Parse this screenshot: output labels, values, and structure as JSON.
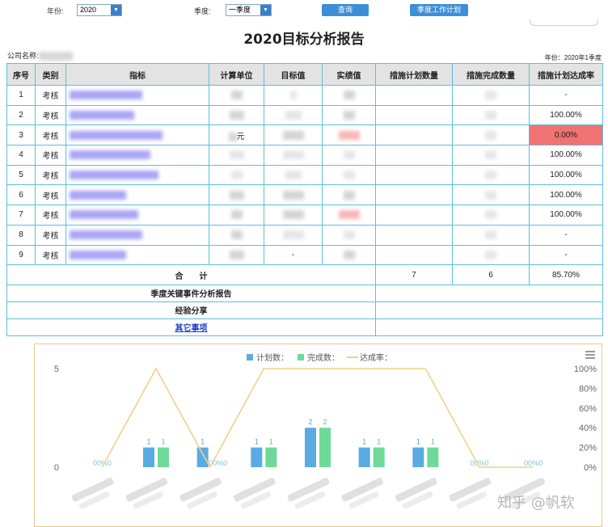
{
  "filters": {
    "year_label": "年份:",
    "year_value": "2020",
    "quarter_label": "季度:",
    "quarter_value": "一季度",
    "query_button": "查询",
    "plan_button": "季度工作计划"
  },
  "report": {
    "title": "2020目标分析报告",
    "company_label": "公司名称:",
    "year_info": "年份：2020年1季度"
  },
  "table": {
    "headers": [
      "序号",
      "类别",
      "指标",
      "计算单位",
      "目标值",
      "实绩值",
      "措施计划数量",
      "措施完成数量",
      "措施计划达成率"
    ],
    "rows": [
      {
        "no": "1",
        "cat": "考核",
        "unit": "",
        "target": "",
        "plan": "",
        "done": "",
        "rate": "-"
      },
      {
        "no": "2",
        "cat": "考核",
        "unit": "",
        "target": "",
        "plan": "",
        "done": "",
        "rate": "100.00%"
      },
      {
        "no": "3",
        "cat": "考核",
        "unit": "元",
        "target": "",
        "plan": "",
        "done": "",
        "rate": "0.00%"
      },
      {
        "no": "4",
        "cat": "考核",
        "unit": "",
        "target": "",
        "plan": "",
        "done": "",
        "rate": "100.00%"
      },
      {
        "no": "5",
        "cat": "考核",
        "unit": "",
        "target": "",
        "plan": "",
        "done": "",
        "rate": "100.00%"
      },
      {
        "no": "6",
        "cat": "考核",
        "unit": "",
        "target": "",
        "plan": "",
        "done": "",
        "rate": "100.00%"
      },
      {
        "no": "7",
        "cat": "考核",
        "unit": "",
        "target": "",
        "plan": "",
        "done": "",
        "rate": "100.00%"
      },
      {
        "no": "8",
        "cat": "考核",
        "unit": "",
        "target": "",
        "plan": "",
        "done": "",
        "rate": "-"
      },
      {
        "no": "9",
        "cat": "考核",
        "unit": "",
        "target": "-",
        "plan": "",
        "done": "",
        "rate": "-"
      }
    ],
    "total_label": "合　　计",
    "total_plan": "7",
    "total_done": "6",
    "total_rate": "85.70%",
    "section_event": "季度关键事件分析报告",
    "section_experience": "经验分享",
    "section_other": "其它事项"
  },
  "chart_data": {
    "type": "bar",
    "legend": [
      "计划数：",
      "完成数：",
      "达成率："
    ],
    "legend_position": "top-center",
    "colors": {
      "plan": "#5aabe3",
      "done": "#6fd99a",
      "rate": "#f0d08a"
    },
    "y_left": {
      "min": 0,
      "max": 5,
      "ticks": [
        "0",
        "5"
      ]
    },
    "y_right": {
      "min": 0,
      "max": 100,
      "ticks": [
        "0%",
        "20%",
        "40%",
        "60%",
        "80%",
        "100%"
      ]
    },
    "series": [
      {
        "name": "计划数：",
        "values": [
          0,
          1,
          1,
          1,
          2,
          1,
          1,
          0,
          0
        ]
      },
      {
        "name": "完成数：",
        "values": [
          0,
          1,
          0,
          1,
          2,
          1,
          1,
          0,
          0
        ]
      },
      {
        "name": "达成率：",
        "values": [
          0,
          100,
          0,
          100,
          100,
          100,
          100,
          0,
          0
        ]
      }
    ],
    "data_labels": [
      "00%0",
      "1 1",
      "1 0%0",
      "1 1",
      "2 2",
      "1 1",
      "1 1",
      "00%0",
      "00%0"
    ]
  },
  "watermark": "知乎 @帆软"
}
